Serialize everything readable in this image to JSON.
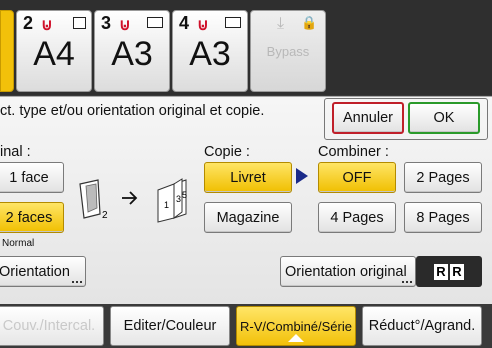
{
  "trays": [
    {
      "num": "2",
      "size": "A4"
    },
    {
      "num": "3",
      "size": "A3"
    },
    {
      "num": "4",
      "size": "A3"
    },
    {
      "label": "Bypass"
    }
  ],
  "message": "ct. type et/ou orientation original et copie.",
  "buttons": {
    "cancel": "Annuler",
    "ok": "OK"
  },
  "original": {
    "heading": "inal :",
    "face1": "1 face",
    "face2": "2 faces",
    "sub": "Normal",
    "orientation": "Orientation"
  },
  "copy": {
    "heading": "Copie :",
    "booklet": "Livret",
    "magazine": "Magazine"
  },
  "combine": {
    "heading": "Combiner :",
    "off": "OFF",
    "p2": "2 Pages",
    "p4": "4 Pages",
    "p8": "8 Pages"
  },
  "orientation_original": "Orientation original",
  "orientation_badge": "R R",
  "diagram": {
    "original_sub": "2",
    "booklet_pages": [
      "1",
      "3",
      "5"
    ]
  },
  "tabs": [
    {
      "label": "Couv./Intercal."
    },
    {
      "label": "Editer/Couleur"
    },
    {
      "label": "R-V/Combiné/Série"
    },
    {
      "label": "Réduct°/Agrand."
    }
  ],
  "colors": {
    "accent": "#f2c10a",
    "ok_border": "#2a9a2a",
    "cancel_border": "#c0202a",
    "paper_icon": "#d0102a"
  }
}
